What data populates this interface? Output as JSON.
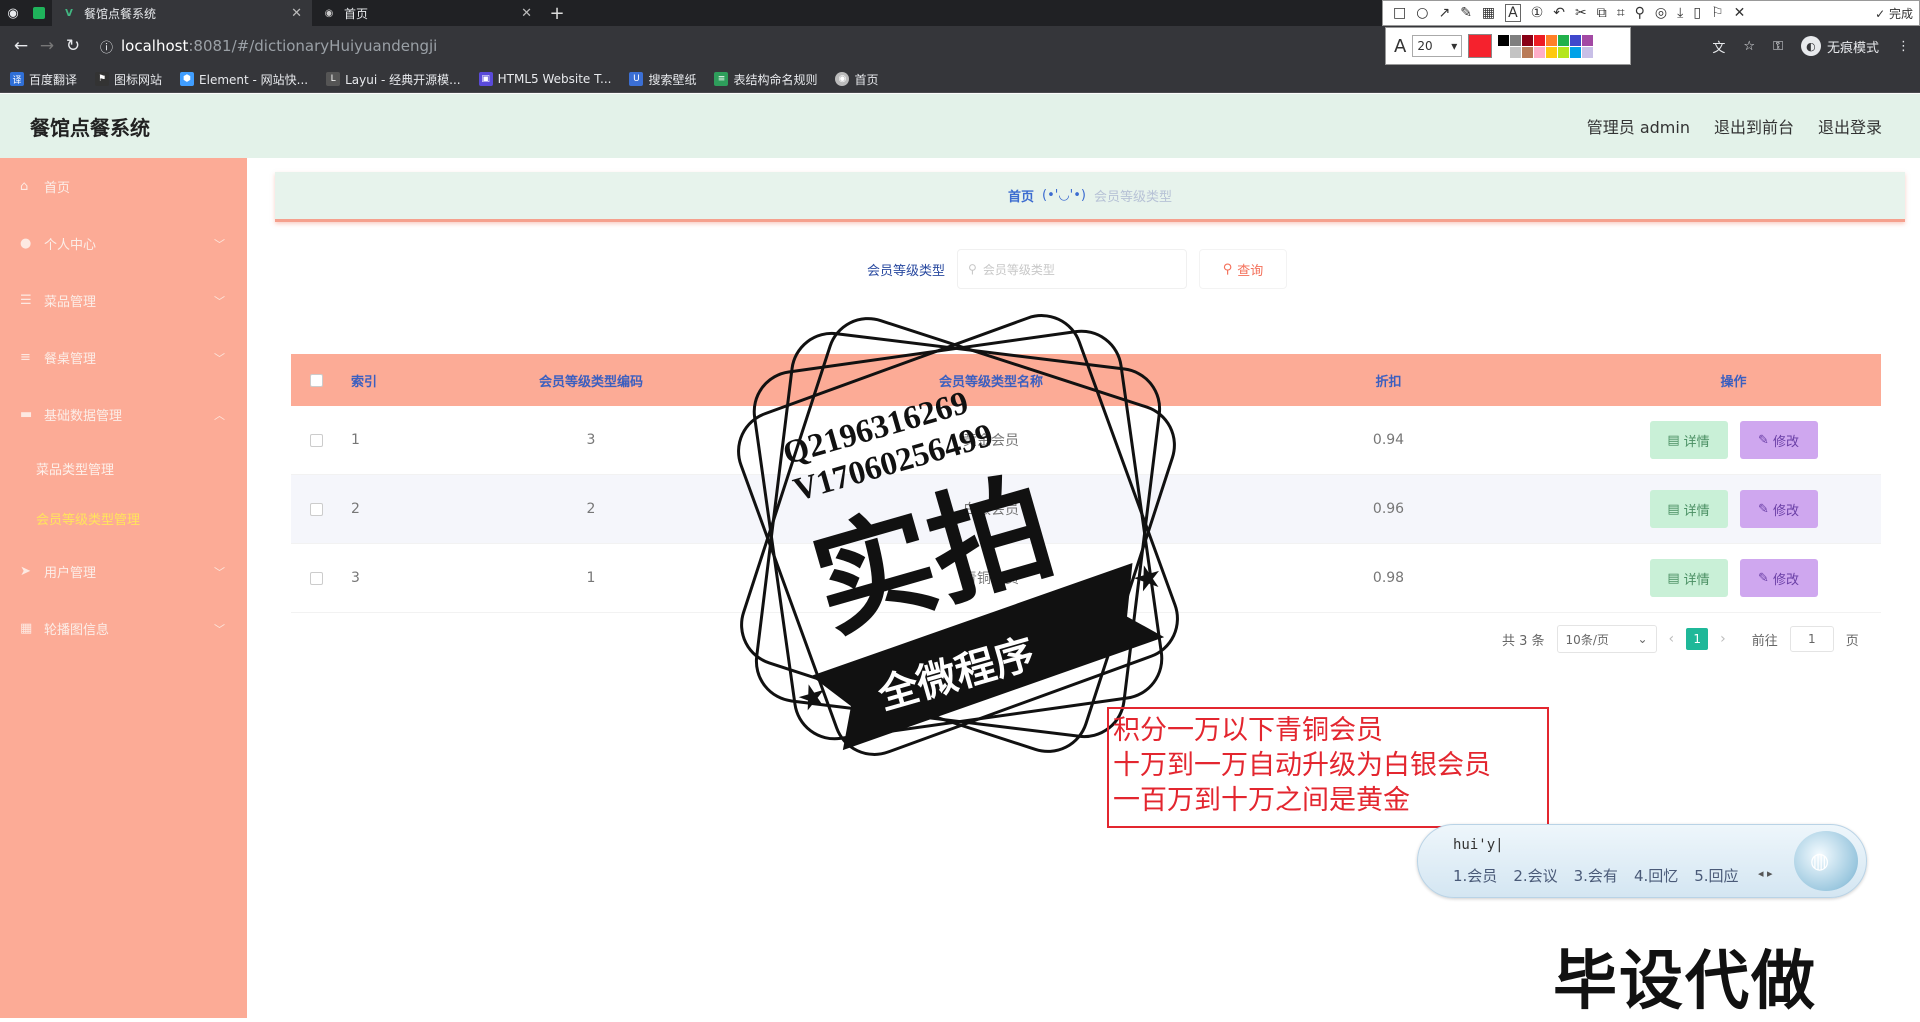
{
  "browser": {
    "tabs": [
      {
        "title": "餐馆点餐系统"
      },
      {
        "title": "首页"
      }
    ],
    "new_tab": "+",
    "url_host": "localhost",
    "url_path": ":8081/#/dictionaryHuiyuandengji",
    "incognito_label": "无痕模式",
    "bookmarks": [
      {
        "label": "百度翻译",
        "color": "#2f6fd6"
      },
      {
        "label": "图标网站",
        "color": "#333333"
      },
      {
        "label": "Element - 网站快...",
        "color": "#409eff"
      },
      {
        "label": "Layui - 经典开源模...",
        "color": "#555555"
      },
      {
        "label": "HTML5 Website T...",
        "color": "#5a4ad9"
      },
      {
        "label": "搜索壁纸",
        "color": "#3b6fd4"
      },
      {
        "label": "表结构命名规则",
        "color": "#2e9e5b"
      },
      {
        "label": "首页",
        "color": "#bbbbbb"
      }
    ]
  },
  "snip_toolbar": {
    "done_label": "完成",
    "font_size": "20",
    "current_color": "#f5222d",
    "palette": [
      "#000000",
      "#7f7f7f",
      "#880015",
      "#ed1c24",
      "#ff7f27",
      "#22b14c",
      "#3f48cc",
      "#a349a4",
      "#ffffff",
      "#c3c3c3",
      "#b97a57",
      "#ffaec9",
      "#ffc90e",
      "#b5e61d",
      "#00a2e8",
      "#c8bfe7"
    ]
  },
  "app": {
    "title": "餐馆点餐系统",
    "header_links": {
      "user": "管理员 admin",
      "to_front": "退出到前台",
      "logout": "退出登录"
    }
  },
  "sidebar": {
    "items": [
      {
        "label": "首页",
        "icon": "home-icon"
      },
      {
        "label": "个人中心",
        "icon": "user-icon"
      },
      {
        "label": "菜品管理",
        "icon": "list-icon"
      },
      {
        "label": "餐桌管理",
        "icon": "menu-icon"
      },
      {
        "label": "基础数据管理",
        "icon": "database-icon"
      },
      {
        "label": "菜品类型管理",
        "icon": ""
      },
      {
        "label": "会员等级类型管理",
        "icon": ""
      },
      {
        "label": "用户管理",
        "icon": "send-icon"
      },
      {
        "label": "轮播图信息",
        "icon": "grid-icon"
      }
    ]
  },
  "breadcrumb": {
    "home": "首页",
    "face": "(•'◡'•)",
    "current": "会员等级类型"
  },
  "search": {
    "label": "会员等级类型",
    "placeholder": "会员等级类型",
    "button": "查询"
  },
  "table": {
    "headers": {
      "index": "索引",
      "code": "会员等级类型编码",
      "name": "会员等级类型名称",
      "discount": "折扣",
      "ops": "操作"
    },
    "rows": [
      {
        "index": "1",
        "code": "3",
        "name": "黄金会员",
        "discount": "0.94"
      },
      {
        "index": "2",
        "code": "2",
        "name": "白银会员",
        "discount": "0.96"
      },
      {
        "index": "3",
        "code": "1",
        "name": "青铜会员",
        "discount": "0.98"
      }
    ],
    "detail_label": "详情",
    "edit_label": "修改"
  },
  "pagination": {
    "total": "共 3 条",
    "page_size": "10条/页",
    "current": "1",
    "goto_label": "前往",
    "goto_value": "1",
    "page_unit": "页"
  },
  "overlays": {
    "stamp": {
      "qq": "Q2196316269",
      "vx": "V17060256499",
      "big": "实拍",
      "ribbon": "全微程序"
    },
    "note": {
      "lines": [
        "积分一万以下青铜会员",
        "十万到一万自动升级为白银会员",
        "一百万到十万之间是黄金"
      ]
    },
    "ime": {
      "input": "hui'y|",
      "candidates": [
        "1.会员",
        "2.会议",
        "3.会有",
        "4.回忆",
        "5.回应"
      ]
    },
    "watermark": "毕设代做"
  }
}
